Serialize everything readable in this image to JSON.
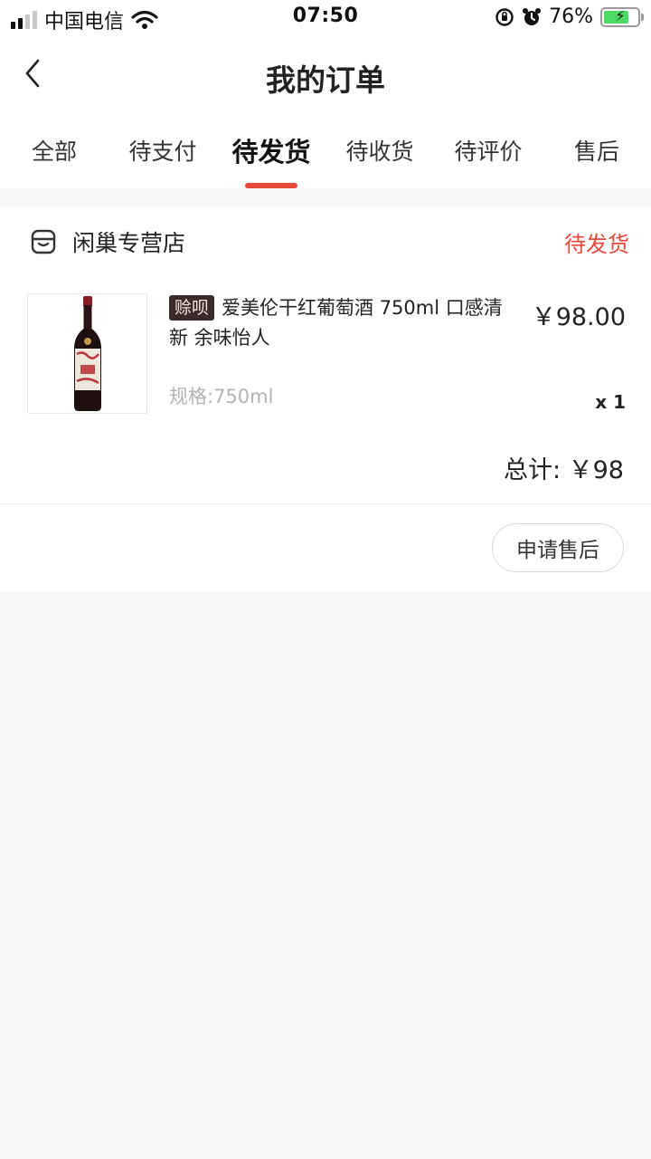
{
  "status_bar": {
    "carrier": "中国电信",
    "time": "07:50",
    "battery": "76%",
    "battery_level": 0.76
  },
  "nav": {
    "title": "我的订单",
    "back_icon": "chevron-left-icon"
  },
  "tabs": [
    {
      "label": "全部",
      "active": false
    },
    {
      "label": "待支付",
      "active": false
    },
    {
      "label": "待发货",
      "active": true
    },
    {
      "label": "待收货",
      "active": false
    },
    {
      "label": "待评价",
      "active": false
    },
    {
      "label": "售后",
      "active": false
    }
  ],
  "order": {
    "shop_name": "闲巢专营店",
    "status": "待发货",
    "item": {
      "tag": "赊呗",
      "title": "爱美伦干红葡萄酒 750ml 口感清新 余味怡人",
      "spec": "规格:750ml",
      "price": "￥98.00",
      "quantity": "x 1"
    },
    "total": "总计: ￥98",
    "action_label": "申请售后"
  },
  "colors": {
    "accent": "#e8473a",
    "tag_bg": "#3a2a2a",
    "page_bg": "#f8f8f8"
  }
}
